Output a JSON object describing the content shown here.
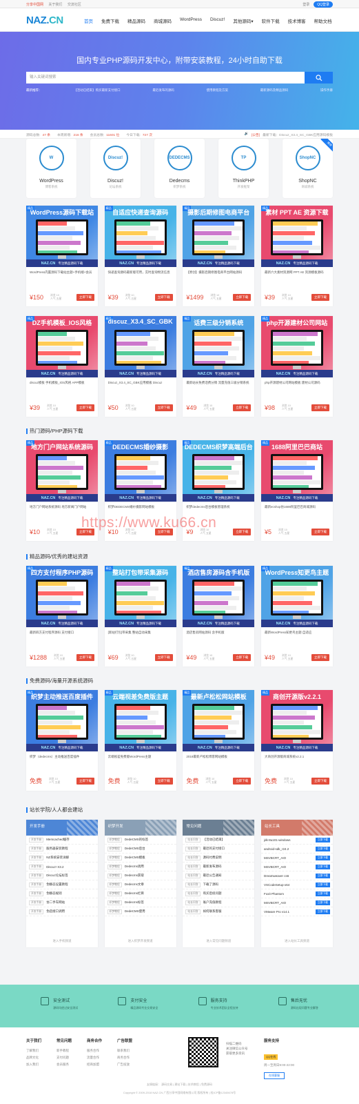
{
  "topbar": {
    "links": [
      "分享中国网",
      "关于我们",
      "交流社区"
    ],
    "right": [
      "登录",
      "QQ登录"
    ]
  },
  "logo": {
    "a": "NAZ.",
    "b": "CN"
  },
  "nav": [
    "首页",
    "免费下载",
    "精品源码",
    "商城源码",
    "WordPress",
    "Discuz!",
    "其他源码▾",
    "软件下载",
    "技术博客",
    "帮助文档"
  ],
  "hero": {
    "title": "国内专业PHP源码开发中心，附带安装教程，24小时自助下载",
    "placeholder": "输入关键词搜索",
    "hot": [
      "最新推荐：",
      "【活动已结束】购买最新支付接口",
      "最近发布的源码",
      "使用教程及方案",
      "最新源码及精品源码",
      "操作手册"
    ]
  },
  "stats": {
    "items": [
      {
        "k": "源码总数:",
        "v": "47 条"
      },
      {
        "k": "本周新增:",
        "v": "216 条"
      },
      {
        "k": "会员总数:",
        "v": "11601 位"
      },
      {
        "k": "今日下载:",
        "v": "727 次"
      }
    ],
    "notice_tag": "[公告]",
    "notice": "最新下载：Discuz_X3.4_SC_GBK应用源码模板"
  },
  "categories": [
    {
      "name": "WordPress",
      "sub": "博客系统",
      "logo": "W",
      "color": "#2a8bcf",
      "ribbon": ""
    },
    {
      "name": "Discuz!",
      "sub": "论坛系统",
      "logo": "Discuz!",
      "color": "#2a8bcf",
      "ribbon": ""
    },
    {
      "name": "Dedecms",
      "sub": "织梦系统",
      "logo": "DEDECMS",
      "color": "#2a8bcf",
      "ribbon": ""
    },
    {
      "name": "ThinkPHP",
      "sub": "开发框架",
      "logo": "TP",
      "color": "#2a8bcf",
      "ribbon": ""
    },
    {
      "name": "ShopNC",
      "sub": "商城系统",
      "logo": "ShopNC",
      "color": "#2a8bcf",
      "ribbon": "推荐"
    }
  ],
  "sections": [
    "热门源码/PHP源码下载",
    "精品源码/优秀的建站资源",
    "免费源码/海量开源系统源码",
    "站长学院/人人都会建站"
  ],
  "banner": {
    "brand": "NAZ.CN",
    "text": "专注精品源码下载"
  },
  "card_labels": {
    "meta1": "浏览 10",
    "meta2": "人气 五星",
    "download": "立即下载",
    "tag": "精品"
  },
  "grids": [
    [
      {
        "title": "WordPress源码下载站",
        "desc": "WordPress内置源码下载站主题+手机端+会员",
        "price": "¥150",
        "color": "#3f87e4"
      },
      {
        "title": "自适应快递查询源码",
        "desc": "快递查询源码最新版可用，实时查询物流信息",
        "price": "¥39",
        "color": "#47b3e8"
      },
      {
        "title": "摄影后期修图电商平台",
        "desc": "【原创】摄影后期修图电商平台网站源码",
        "price": "¥1499",
        "color": "#4fa3e6"
      },
      {
        "title": "素材 PPT AE 资源下载",
        "desc": "最新六大素材资源网 PPT AE 资源模板源码",
        "price": "¥39",
        "color": "#e84a6e"
      }
    ],
    [
      {
        "title": "DZ手机模板_IOS风格",
        "desc": "discuz模板 手机模板_IOS风格 APP模板",
        "price": "¥39",
        "color": "#e84a6e"
      },
      {
        "title": "discuz_X3.4_SC_GBK",
        "desc": "Discuz_X3.4_SC_GBK应用模板 Discuz",
        "price": "¥50",
        "color": "#3c7de0"
      },
      {
        "title": "话费三级分销系统",
        "desc": "最新站长免费话费分销 流量充值三级分销系统",
        "price": "¥49",
        "color": "#4fa3e6"
      },
      {
        "title": "php开源建材公司网站",
        "desc": "php开源建材公司网站模板 建材公司源码",
        "price": "¥98",
        "color": "#e84a6e"
      }
    ],
    [
      {
        "title": "地方门户网站系统源码",
        "desc": "地方门户网站系统源码 地方新闻门户网站",
        "price": "¥10",
        "color": "#e84a6e"
      },
      {
        "title": "DEDECMS婚纱摄影",
        "desc": "织梦DEDECMS婚纱摄影网站模板",
        "price": "¥10",
        "color": "#3c7de0"
      },
      {
        "title": "DEDECMS织梦高端后台",
        "desc": "织梦dedecms后台模板管理系统",
        "price": "¥9",
        "color": "#47b3e8"
      },
      {
        "title": "1688阿里巴巴商站",
        "desc": "最新ecshop仿1688阿里巴巴商城源码",
        "price": "¥5",
        "color": "#e84a6e"
      }
    ],
    [
      {
        "title": "四方支付程序PHP源码",
        "desc": "最新四方支付程序源码 支付接口",
        "price": "¥1288",
        "color": "#3c7de0"
      },
      {
        "title": "整站打包带采集源码",
        "desc": "[新站打包]带采集 整站自动采集",
        "price": "¥69",
        "color": "#47b3e8"
      },
      {
        "title": "酒店售房源码含手机版",
        "desc": "酒店售房网站源码 含手机版",
        "price": "¥49",
        "color": "#3c7de0"
      },
      {
        "title": "WordPress知更鸟主题",
        "desc": "最新WordPress知更鸟主题 自适应",
        "price": "¥49",
        "color": "#4fa3e6"
      }
    ],
    [
      {
        "title": "织梦主动推送百度插件",
        "desc": "织梦（dedecms）主动推送百度插件",
        "price": "免费",
        "color": "#3c7de0"
      },
      {
        "title": "云端视差免费版主题",
        "desc": "云端视差免费版WordPress主题",
        "price": "免费",
        "color": "#47b3e8"
      },
      {
        "title": "最新卢松松网站模板",
        "desc": "2018最新卢松松博客网站模板",
        "price": "免费",
        "color": "#4fa3e6"
      },
      {
        "title": "商创开源版v2.2.1",
        "desc": "大商创开源版商城系统v2.2.1",
        "price": "免费",
        "color": "#e84a6e"
      }
    ]
  ],
  "blog": [
    {
      "head": "开发手册",
      "color": "#4d86d6",
      "items": [
        [
          "开发手册",
          "Memcached缓存"
        ],
        [
          "开发手册",
          "服务器安装教程"
        ],
        [
          "开发手册",
          "NZ系统安装详解"
        ],
        [
          "开发手册",
          "Discuz! X3.2"
        ],
        [
          "开发手册",
          "Discuz论坛标签"
        ],
        [
          "开发手册",
          "伪静态设置教程"
        ],
        [
          "开发手册",
          "伪静态规则"
        ],
        [
          "开发手册",
          "仿二手车网站"
        ],
        [
          "开发手册",
          "伪造接口调用"
        ]
      ],
      "more": "进入手机频道"
    },
    {
      "head": "织梦开发",
      "color": "#8aa0b6",
      "items": [
        [
          "织梦教程",
          "DedeCMS的标签"
        ],
        [
          "织梦教程",
          "DedeCMS后台"
        ],
        [
          "织梦教程",
          "DedeCMS模板"
        ],
        [
          "织梦教程",
          "Dedecms调用"
        ],
        [
          "织梦教程",
          "Dedecms获取"
        ],
        [
          "织梦教程",
          "Dedecms文章"
        ],
        [
          "织梦教程",
          "Dedecms栏目"
        ],
        [
          "织梦教程",
          "Dedecms标签"
        ],
        [
          "织梦教程",
          "DedeCMS使用"
        ]
      ],
      "more": "进入织梦开发频道"
    },
    {
      "head": "常见问题",
      "color": "#6b7f93",
      "items": [
        [
          "站长问答",
          "【活动已结束】"
        ],
        [
          "站长问答",
          "最近的支付接口"
        ],
        [
          "站长问答",
          "源码付费说明"
        ],
        [
          "站长问答",
          "最新发布源码"
        ],
        [
          "站长问答",
          "最近公告通知"
        ],
        [
          "站长问答",
          "下载了源码"
        ],
        [
          "站长问答",
          "购买后续问题"
        ],
        [
          "站长问答",
          "账户充值教程"
        ],
        [
          "站长问答",
          "如何联系客服"
        ]
      ],
      "more": "进入常见问题频道"
    },
    {
      "head": "站长工具",
      "color": "#d27a6a",
      "items": [
        [
          "",
          "jdk-8u101-windows"
        ],
        [
          "",
          "android-sdk_r24.2"
        ],
        [
          "",
          "MSVBCRT_AIO"
        ],
        [
          "",
          "MSVBCRT_AIO"
        ],
        [
          "",
          "Dreamweaver cs6"
        ],
        [
          "",
          "VSCodeSetup-x64"
        ],
        [
          "",
          "Foxit Phantom"
        ],
        [
          "",
          "MSVBCRT_AIO"
        ],
        [
          "",
          "VMware Pro v14.1"
        ]
      ],
      "dl": "立即下载",
      "more": "进入站长工具频道"
    }
  ],
  "watermark": "https://www.ku66.cn",
  "features": [
    {
      "t": "安全测试",
      "s": "源码均经过安全测试"
    },
    {
      "t": "支付安全",
      "s": "精品源码专业交易安全"
    },
    {
      "t": "服务支持",
      "s": "专业技术团队全程支持"
    },
    {
      "t": "售后无忧",
      "s": "源码出现问题专业解答"
    }
  ],
  "footer": {
    "cols": [
      {
        "h": "关于我们",
        "p": [
          "了解我们",
          "品牌文化",
          "加入我们"
        ]
      },
      {
        "h": "常见问题",
        "p": [
          "新手教程",
          "支付问题",
          "会员服务"
        ]
      },
      {
        "h": "商务合作",
        "p": [
          "服务合作",
          "流量合作",
          "招商加盟"
        ]
      },
      {
        "h": "广告联盟",
        "p": [
          "联系我们",
          "商务合作",
          "广告投放"
        ]
      }
    ],
    "qr_text": [
      "扫描二维码",
      "关注微信公众号",
      "获取更多资讯"
    ],
    "svc_h": "服务支持",
    "svc_qq": "QQ在线",
    "svc_time": "周一至周日9:00-22:00",
    "svc_btn": "在线客服",
    "links": "友情链接： 源码交易 | 建站下载 | 技术教程 | 免费源码",
    "copy": "Copyright © 2009-2018 NAZ.CN 广西分享中国网络有限公司 版权所有 | 桂ICP备12345678号"
  }
}
